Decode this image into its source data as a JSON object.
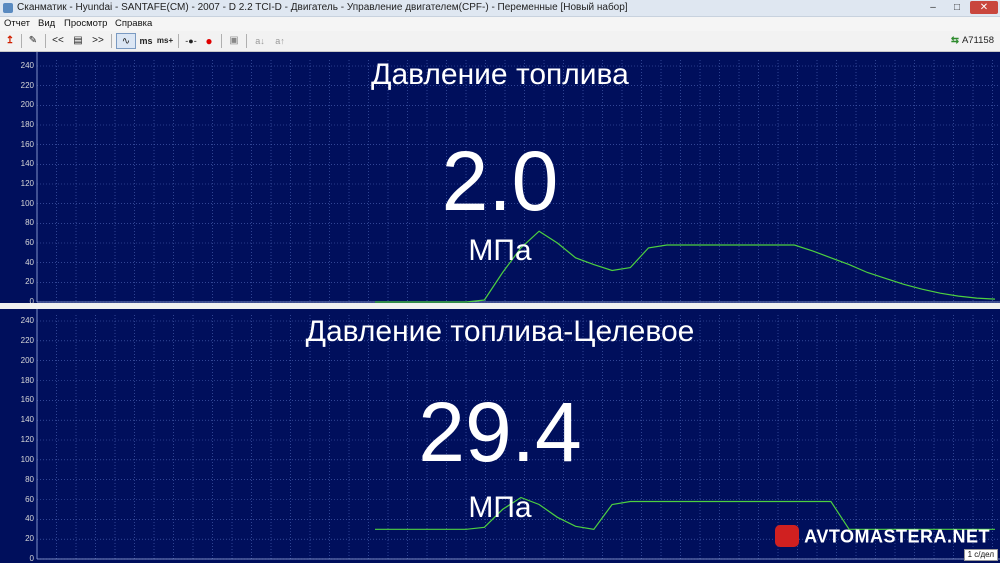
{
  "window": {
    "title": "Сканматик - Hyundai - SANTAFE(CM) - 2007 - D 2.2 TCI-D - Двигатель - Управление двигателем(CPF-) - Переменные [Новый набор]",
    "minimize_glyph": "–",
    "maximize_glyph": "□",
    "close_glyph": "✕"
  },
  "menu": [
    "Отчет",
    "Вид",
    "Просмотр",
    "Справка"
  ],
  "toolbar": {
    "buttons": [
      {
        "icon": "red-arrow-icon",
        "glyph": "↥"
      },
      {
        "icon": "edit-icon",
        "glyph": "✎"
      },
      {
        "icon": "rewind-icon",
        "glyph": "<<"
      },
      {
        "icon": "list-icon",
        "glyph": "▤"
      },
      {
        "icon": "fast-forward-icon",
        "glyph": ">>"
      },
      {
        "icon": "graph-mode-icon",
        "glyph": "∿"
      },
      {
        "icon": "ms-icon",
        "glyph": "ms"
      },
      {
        "icon": "ms-plus-icon",
        "glyph": "ms+"
      },
      {
        "icon": "marker-icon",
        "glyph": "-●-"
      },
      {
        "icon": "record-icon",
        "glyph": "●"
      },
      {
        "icon": "save-icon",
        "glyph": "▣"
      },
      {
        "icon": "a-down-icon",
        "glyph": "a↓"
      },
      {
        "icon": "a-up-icon",
        "glyph": "a↑"
      }
    ],
    "device_id": "A71158",
    "record_color": "#e00000"
  },
  "y_ticks": [
    "240",
    "220",
    "200",
    "180",
    "160",
    "140",
    "120",
    "100",
    "80",
    "60",
    "40",
    "20",
    "0"
  ],
  "plots": [
    {
      "title": "Давление топлива",
      "value": "2.0",
      "unit": "МПа"
    },
    {
      "title": "Давление топлива-Целевое",
      "value": "29.4",
      "unit": "МПа"
    }
  ],
  "chart_data": [
    {
      "type": "line",
      "series": [
        {
          "x": [
            0,
            1,
            2,
            3,
            4,
            5,
            6,
            7,
            8,
            9,
            10,
            11,
            12,
            13,
            14,
            15,
            16,
            17,
            18,
            19,
            20,
            21,
            22,
            23,
            24,
            25,
            26,
            27,
            28,
            29,
            30,
            31,
            32,
            33,
            34
          ],
          "values": [
            0,
            0,
            0,
            0,
            0,
            0,
            2,
            30,
            55,
            72,
            60,
            45,
            38,
            32,
            35,
            55,
            58,
            58,
            58,
            58,
            58,
            58,
            58,
            58,
            52,
            45,
            38,
            30,
            24,
            18,
            13,
            9,
            6,
            4,
            3
          ]
        }
      ],
      "ylim": [
        0,
        240
      ],
      "color": "#4dd040"
    },
    {
      "type": "line",
      "series": [
        {
          "x": [
            0,
            1,
            2,
            3,
            4,
            5,
            6,
            7,
            8,
            9,
            10,
            11,
            12,
            13,
            14,
            15,
            16,
            17,
            18,
            19,
            20,
            21,
            22,
            23,
            24,
            25,
            26,
            27,
            28,
            29,
            30,
            31,
            32,
            33,
            34
          ],
          "values": [
            30,
            30,
            30,
            30,
            30,
            30,
            32,
            50,
            62,
            55,
            42,
            33,
            30,
            55,
            58,
            58,
            58,
            58,
            58,
            58,
            58,
            58,
            58,
            58,
            58,
            58,
            30,
            30,
            30,
            30,
            30,
            30,
            30,
            30,
            30
          ]
        }
      ],
      "ylim": [
        0,
        240
      ],
      "color": "#4dd040"
    }
  ],
  "watermark": "AVTOMASTERA.NET",
  "scale_label": "1 с/дел"
}
